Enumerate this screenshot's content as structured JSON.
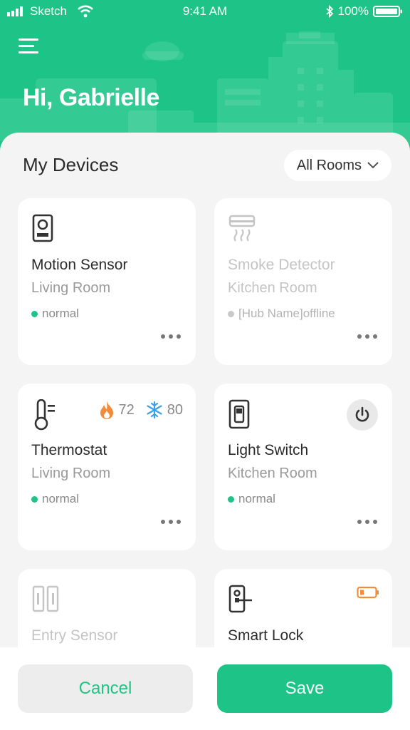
{
  "statusbar": {
    "carrier": "Sketch",
    "time": "9:41 AM",
    "battery": "100%"
  },
  "header": {
    "greeting": "Hi, Gabrielle"
  },
  "section": {
    "title": "My Devices",
    "filter_label": "All Rooms"
  },
  "colors": {
    "accent": "#1ec487",
    "flame": "#f28b3a",
    "snow": "#3ba0e6"
  },
  "devices": [
    {
      "name": "Motion Sensor",
      "room": "Living Room",
      "status": "normal",
      "icon": "motion-sensor-icon"
    },
    {
      "name": "Smoke Detector",
      "room": "Kitchen Room",
      "status": "[Hub Name]offline",
      "icon": "smoke-detector-icon"
    },
    {
      "name": "Thermostat",
      "room": "Living Room",
      "status": "normal",
      "icon": "thermometer-icon",
      "heat": "72",
      "cool": "80"
    },
    {
      "name": "Light Switch",
      "room": "Kitchen Room",
      "status": "normal",
      "icon": "light-switch-icon"
    },
    {
      "name": "Entry Sensor",
      "icon": "entry-sensor-icon"
    },
    {
      "name": "Smart Lock",
      "icon": "smart-lock-icon"
    }
  ],
  "footer": {
    "cancel_label": "Cancel",
    "save_label": "Save"
  }
}
